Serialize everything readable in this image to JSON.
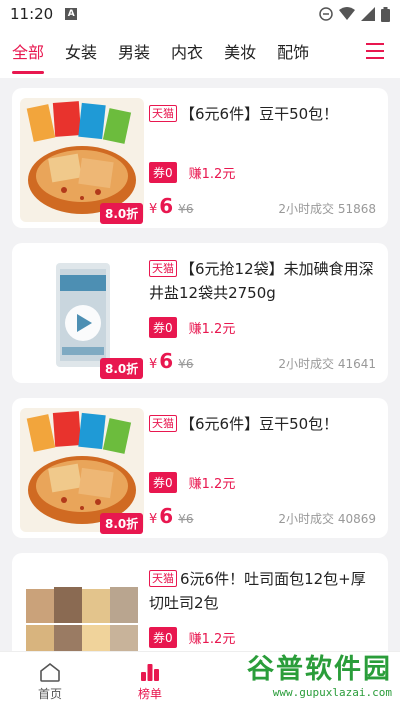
{
  "status": {
    "time": "11:20",
    "a_badge": "A"
  },
  "tabs": [
    {
      "label": "全部",
      "active": true
    },
    {
      "label": "女装"
    },
    {
      "label": "男装"
    },
    {
      "label": "内衣"
    },
    {
      "label": "美妆"
    },
    {
      "label": "配饰"
    }
  ],
  "icons": {
    "menu": "menu-icon",
    "home": "home-icon",
    "rank": "ranking-icon",
    "play": "play-icon"
  },
  "colors": {
    "accent": "#e8174f",
    "watermark": "#2a9d3a"
  },
  "products": [
    {
      "store": "天猫",
      "title": "【6元6件】豆干50包！",
      "coupon": "券0",
      "earn": "赚1.2元",
      "currency": "¥",
      "price": "6",
      "old_price": "¥6",
      "sales": "2小时成交 51868",
      "discount": "8.0折"
    },
    {
      "store": "天猫",
      "title": "【6元抢12袋】未加碘食用深井盐12袋共2750g",
      "coupon": "券0",
      "earn": "赚1.2元",
      "currency": "¥",
      "price": "6",
      "old_price": "¥6",
      "sales": "2小时成交 41641",
      "discount": "8.0折"
    },
    {
      "store": "天猫",
      "title": "【6元6件】豆干50包！",
      "coupon": "券0",
      "earn": "赚1.2元",
      "currency": "¥",
      "price": "6",
      "old_price": "¥6",
      "sales": "2小时成交 40869",
      "discount": "8.0折"
    },
    {
      "store": "天猫",
      "title": "6沅6件！吐司面包12包+厚切吐司2包",
      "coupon": "券0",
      "earn": "赚1.2元"
    }
  ],
  "bottom_nav": [
    {
      "label": "首页"
    },
    {
      "label": "榜单",
      "active": true
    }
  ],
  "watermark": {
    "cn": "谷普软件园",
    "en": "www.gupuxlazai.com"
  }
}
